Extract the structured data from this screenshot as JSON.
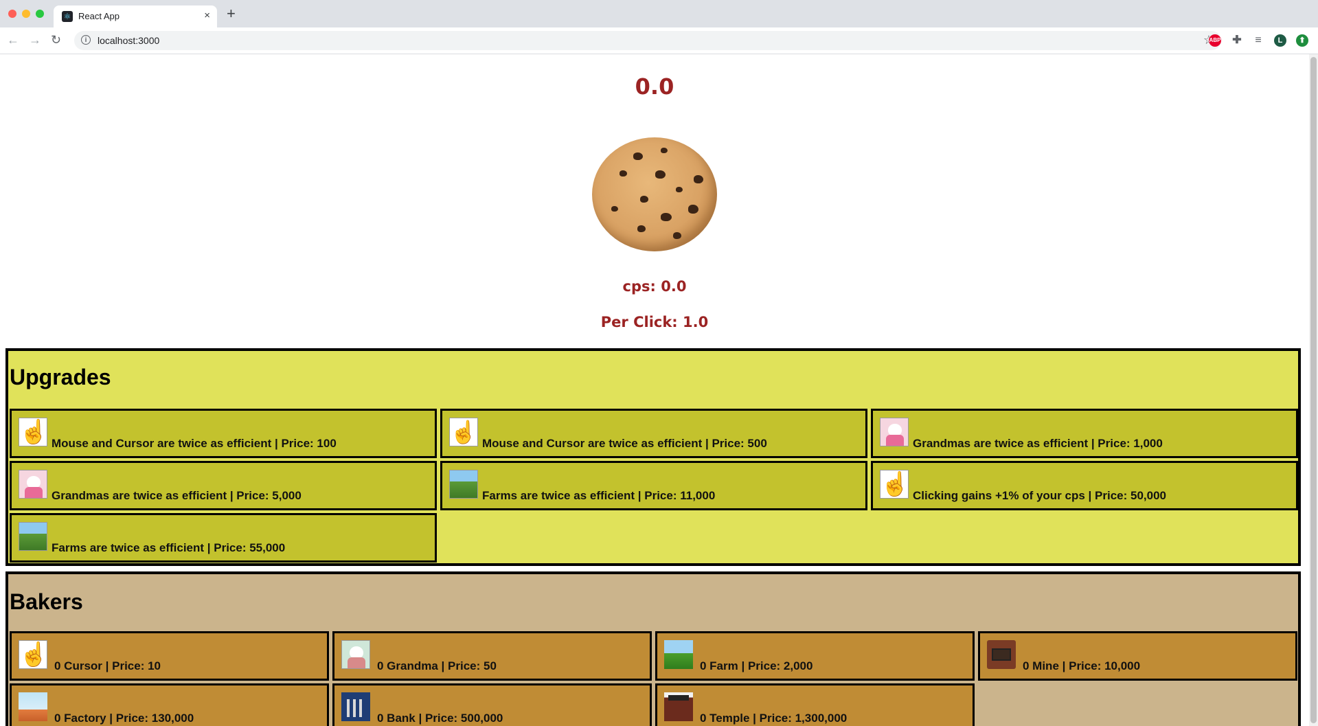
{
  "browser": {
    "tab_title": "React App",
    "tab_close": "×",
    "new_tab": "+",
    "url": "localhost:3000",
    "ext_abp": "ABP",
    "ext_avatar": "L",
    "ext_update": "⬆"
  },
  "game": {
    "cookies": "0.0",
    "cps": "cps: 0.0",
    "per_click": "Per Click: 1.0"
  },
  "upgrades": {
    "title": "Upgrades",
    "items": [
      {
        "label": "Mouse and Cursor are twice as efficient | Price: 100",
        "icon": "cursor-icon"
      },
      {
        "label": "Mouse and Cursor are twice as efficient | Price: 500",
        "icon": "red-cursor-icon"
      },
      {
        "label": "Grandmas are twice as efficient | Price: 1,000",
        "icon": "grandma-icon"
      },
      {
        "label": "Grandmas are twice as efficient | Price: 5,000",
        "icon": "grandma-icon"
      },
      {
        "label": "Farms are twice as efficient | Price: 11,000",
        "icon": "farm-icon"
      },
      {
        "label": "Clicking gains +1% of your cps | Price: 50,000",
        "icon": "cursor-icon"
      },
      {
        "label": "Farms are twice as efficient | Price: 55,000",
        "icon": "farm-icon"
      }
    ]
  },
  "bakers": {
    "title": "Bakers",
    "items": [
      {
        "label": "0 Cursor | Price: 10",
        "icon": "cursor-icon"
      },
      {
        "label": "0 Grandma | Price: 50",
        "icon": "grandma-icon"
      },
      {
        "label": "0 Farm | Price: 2,000",
        "icon": "farm-icon"
      },
      {
        "label": "0 Mine | Price: 10,000",
        "icon": "mine-icon"
      },
      {
        "label": "0 Factory | Price: 130,000",
        "icon": "factory-icon"
      },
      {
        "label": "0 Bank | Price: 500,000",
        "icon": "bank-icon"
      },
      {
        "label": "0 Temple | Price: 1,300,000",
        "icon": "temple-icon"
      }
    ]
  }
}
